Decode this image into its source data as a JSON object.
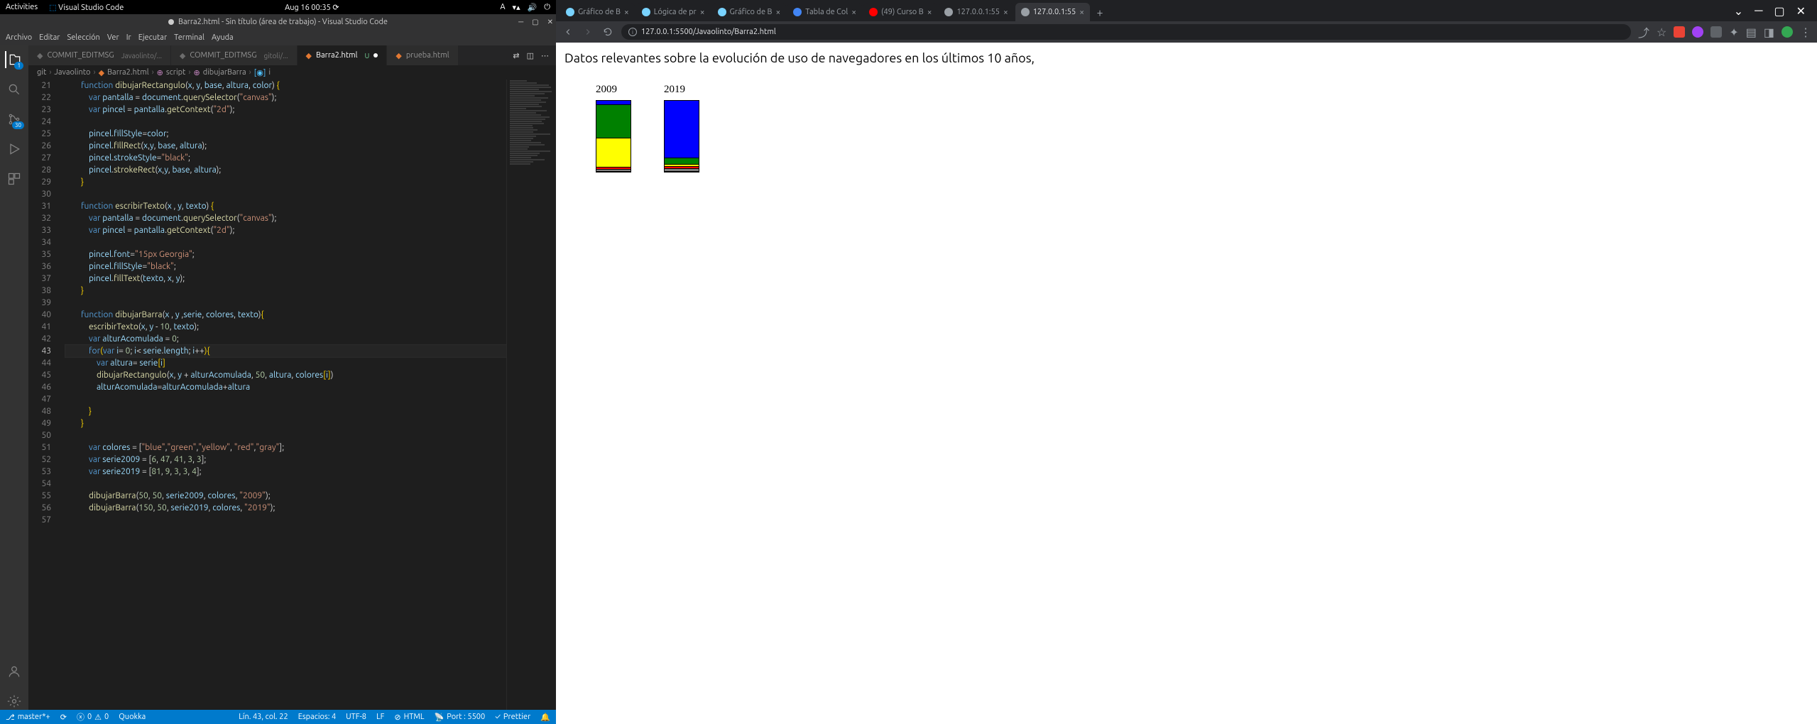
{
  "gnome": {
    "activities": "Activities",
    "app": "Visual Studio Code",
    "datetime": "Aug 16  00:35",
    "lang": "A"
  },
  "vscode": {
    "title": "Barra2.html - Sin título (área de trabajo) - Visual Studio Code",
    "menu": [
      "Archivo",
      "Editar",
      "Selección",
      "Ver",
      "Ir",
      "Ejecutar",
      "Terminal",
      "Ayuda"
    ],
    "activity_badges": {
      "explorer": "1",
      "scm": "30"
    },
    "tabs": [
      {
        "name": "COMMIT_EDITMSG",
        "desc": "Javaolinto/...",
        "active": false,
        "dirty": false
      },
      {
        "name": "COMMIT_EDITMSG",
        "desc": "gitoli/...",
        "active": false,
        "dirty": false
      },
      {
        "name": "Barra2.html",
        "desc": "U",
        "active": true,
        "dirty": true
      },
      {
        "name": "prueba.html",
        "desc": "",
        "active": false,
        "dirty": false
      }
    ],
    "breadcrumbs": [
      "git",
      "Javaolinto",
      "Barra2.html",
      "script",
      "dibujarBarra",
      "i"
    ],
    "status": {
      "branch": "master*+",
      "errors": "0",
      "warnings": "0",
      "quokka": "Quokka",
      "position": "Lín. 43, col. 22",
      "spaces": "Espacios: 4",
      "encoding": "UTF-8",
      "eol": "LF",
      "lang": "HTML",
      "port": "Port : 5500",
      "prettier": "Prettier"
    },
    "line_start": 21,
    "current_line": 43
  },
  "chrome": {
    "tabs": [
      {
        "title": "Gráfico de B",
        "fav": "#79d3ff"
      },
      {
        "title": "Lógica de pr",
        "fav": "#79d3ff"
      },
      {
        "title": "Gráfico de B",
        "fav": "#79d3ff"
      },
      {
        "title": "Tabla de Col",
        "fav": "#4285f4"
      },
      {
        "title": "(49) Curso B",
        "fav": "#ff0000"
      },
      {
        "title": "127.0.0.1:55",
        "fav": "#9aa0a6"
      },
      {
        "title": "127.0.0.1:55",
        "fav": "#9aa0a6",
        "active": true
      }
    ],
    "url": "127.0.0.1:5500/Javaolinto/Barra2.html"
  },
  "page": {
    "heading": "Datos relevantes sobre la evolución de uso de navegadores en los últimos 10 años,"
  },
  "chart_data": {
    "type": "bar",
    "series": [
      {
        "name": "2009",
        "values": [
          6,
          47,
          41,
          3,
          3
        ]
      },
      {
        "name": "2019",
        "values": [
          81,
          9,
          3,
          3,
          4
        ]
      }
    ],
    "colors": [
      "blue",
      "green",
      "yellow",
      "red",
      "gray"
    ],
    "title": "",
    "xlabel": "",
    "ylabel": ""
  }
}
